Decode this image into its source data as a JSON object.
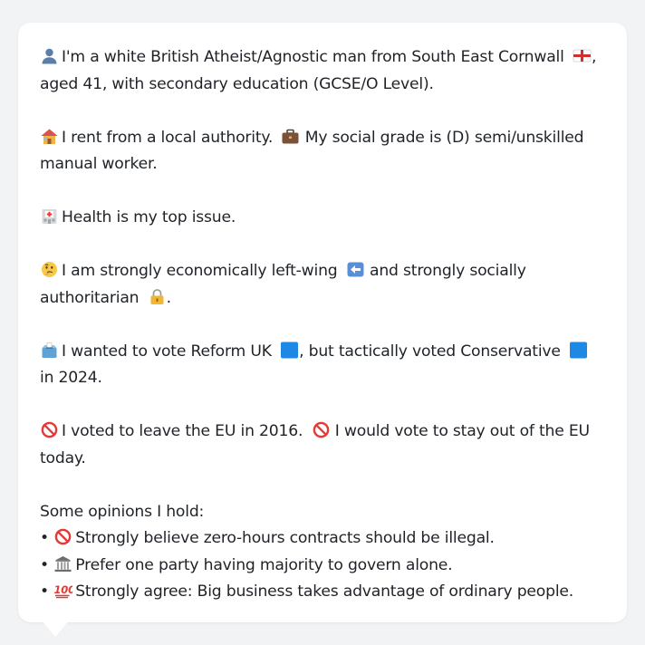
{
  "intro": {
    "line1": "I'm a white British Atheist/Agnostic man from South East Cornwall",
    "line1_tail": ", aged 41, with secondary education (GCSE/O Level)."
  },
  "housing": {
    "text1": "I rent from a local authority.",
    "text2": "My social grade is (D) semi/unskilled manual worker."
  },
  "issue": {
    "text": "Health is my top issue."
  },
  "politics": {
    "text1": "I am strongly economically left-wing",
    "text2": "and strongly socially authoritarian",
    "text3": "."
  },
  "vote": {
    "text1": "I wanted to vote Reform UK",
    "text2": ", but tactically voted Conservative",
    "text3": "in 2024."
  },
  "eu": {
    "text1": "I voted to leave the EU in 2016.",
    "text2": "I would vote to stay out of the EU today."
  },
  "opinions": {
    "heading": "Some opinions I hold:",
    "bullet_char": "•",
    "items": [
      {
        "icon": "prohibited-icon",
        "text": "Strongly believe zero-hours contracts should be illegal."
      },
      {
        "icon": "classical-building-icon",
        "text": "Prefer one party having majority to govern alone."
      },
      {
        "icon": "hundred-points-icon",
        "text": "Strongly agree: Big business takes advantage of ordinary people."
      }
    ]
  },
  "colors": {
    "text": "#1f2328",
    "bubble": "#ffffff",
    "background": "#f1f3f5",
    "reform_square": "#1e88e5",
    "conservative_square": "#1e88e5",
    "prohibited": "#e53935"
  }
}
